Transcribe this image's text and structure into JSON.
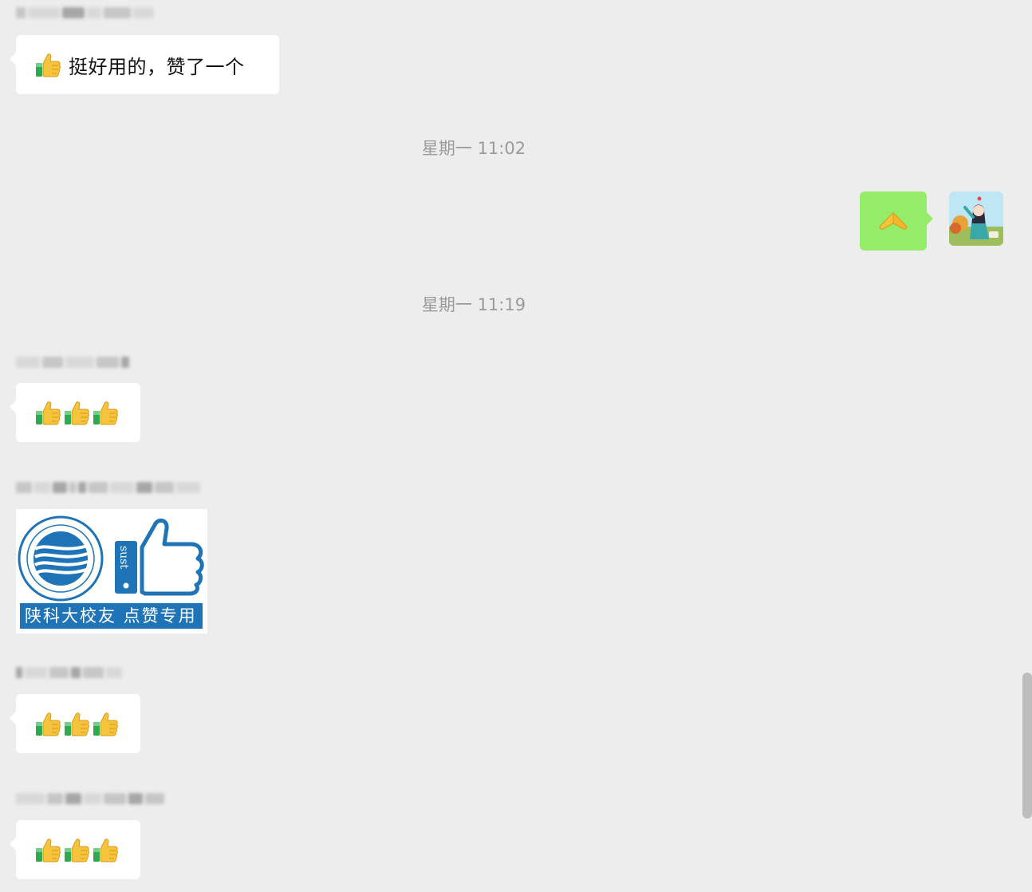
{
  "conversation": {
    "messages": [
      {
        "side": "left",
        "text": "挺好用的，赞了一个",
        "thumb_count": 1
      },
      {
        "time": "星期一 11:02"
      },
      {
        "side": "right",
        "emoji": "🙏"
      },
      {
        "time": "星期一 11:19"
      },
      {
        "side": "left",
        "thumb_count": 3
      },
      {
        "side": "left",
        "sticker_label": "陕科大校友 点赞专用"
      },
      {
        "side": "left",
        "thumb_count": 3
      },
      {
        "side": "left",
        "thumb_count": 3
      }
    ],
    "msg1_text": "挺好用的，赞了一个",
    "time_1": "星期一 11:02",
    "time_2": "星期一 11:19",
    "sticker_label": "陕科大校友 点赞专用",
    "sticker_badge": "sust"
  },
  "colors": {
    "background": "#ededed",
    "bubble_left": "#ffffff",
    "bubble_mine": "#95ec69",
    "time_text": "#9a9a9a",
    "sticker_blue": "#1f74b8"
  },
  "icons": [
    "thumbs-up-icon",
    "pray-hands-icon",
    "avatar-icon",
    "sust-logo-icon"
  ]
}
